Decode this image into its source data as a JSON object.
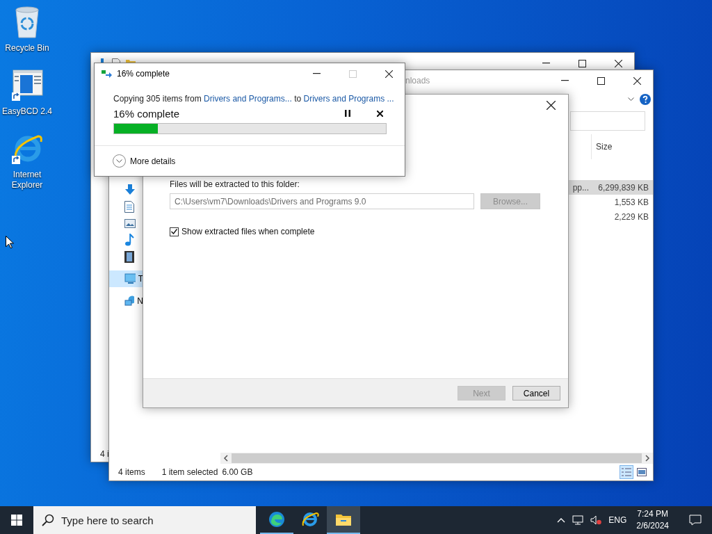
{
  "desktop_icons": [
    {
      "label": "Recycle Bin",
      "kind": "recycle"
    },
    {
      "label": "EasyBCD 2.4",
      "kind": "app"
    },
    {
      "label": "Internet Explorer",
      "kind": "ie"
    }
  ],
  "back_window": {
    "status": "4 i"
  },
  "explorer": {
    "title": "nloads",
    "nav": [
      {
        "kind": "download",
        "selected": false
      },
      {
        "kind": "document",
        "selected": false
      },
      {
        "kind": "pictures",
        "selected": false
      },
      {
        "kind": "music",
        "selected": false
      },
      {
        "kind": "videos",
        "selected": false
      },
      {
        "kind": "pc",
        "label": "T",
        "selected": true
      },
      {
        "kind": "network",
        "label": "N",
        "selected": false
      }
    ],
    "columns": [
      "Size"
    ],
    "rows": [
      {
        "name": "pp...",
        "size": "6,299,839 KB",
        "selected": true
      },
      {
        "size": "1,553 KB",
        "selected": false
      },
      {
        "size": "2,229 KB",
        "selected": false
      }
    ],
    "status": {
      "items": "4 items",
      "selection": "1 item selected",
      "size": "6.00 GB"
    }
  },
  "extract_dialog": {
    "folder_label": "Files will be extracted to this folder:",
    "folder_path": "C:\\Users\\vm7\\Downloads\\Drivers and Programs 9.0",
    "browse": {
      "label": "Browse...",
      "disabled": true
    },
    "show_files": {
      "label": "Show extracted files when complete",
      "checked": true
    },
    "buttons": [
      {
        "label": "Next",
        "disabled": true
      },
      {
        "label": "Cancel",
        "disabled": false
      }
    ]
  },
  "progress_dialog": {
    "title": "16% complete",
    "message": {
      "prefix": "Copying 305 items from",
      "source": "Drivers and Programs...",
      "middle": "to",
      "destination": "Drivers and Programs ..."
    },
    "heading": "16% complete",
    "level": 0.16,
    "more_details": "More details"
  },
  "taskbar": {
    "search_placeholder": "Type here to search",
    "apps": [
      {
        "kind": "edge",
        "selected": false,
        "running": true
      },
      {
        "kind": "ie",
        "selected": false,
        "running": false
      },
      {
        "kind": "explorer",
        "selected": true,
        "running": true
      }
    ],
    "language": "ENG",
    "time": "7:24 PM",
    "date": "2/6/2024"
  }
}
